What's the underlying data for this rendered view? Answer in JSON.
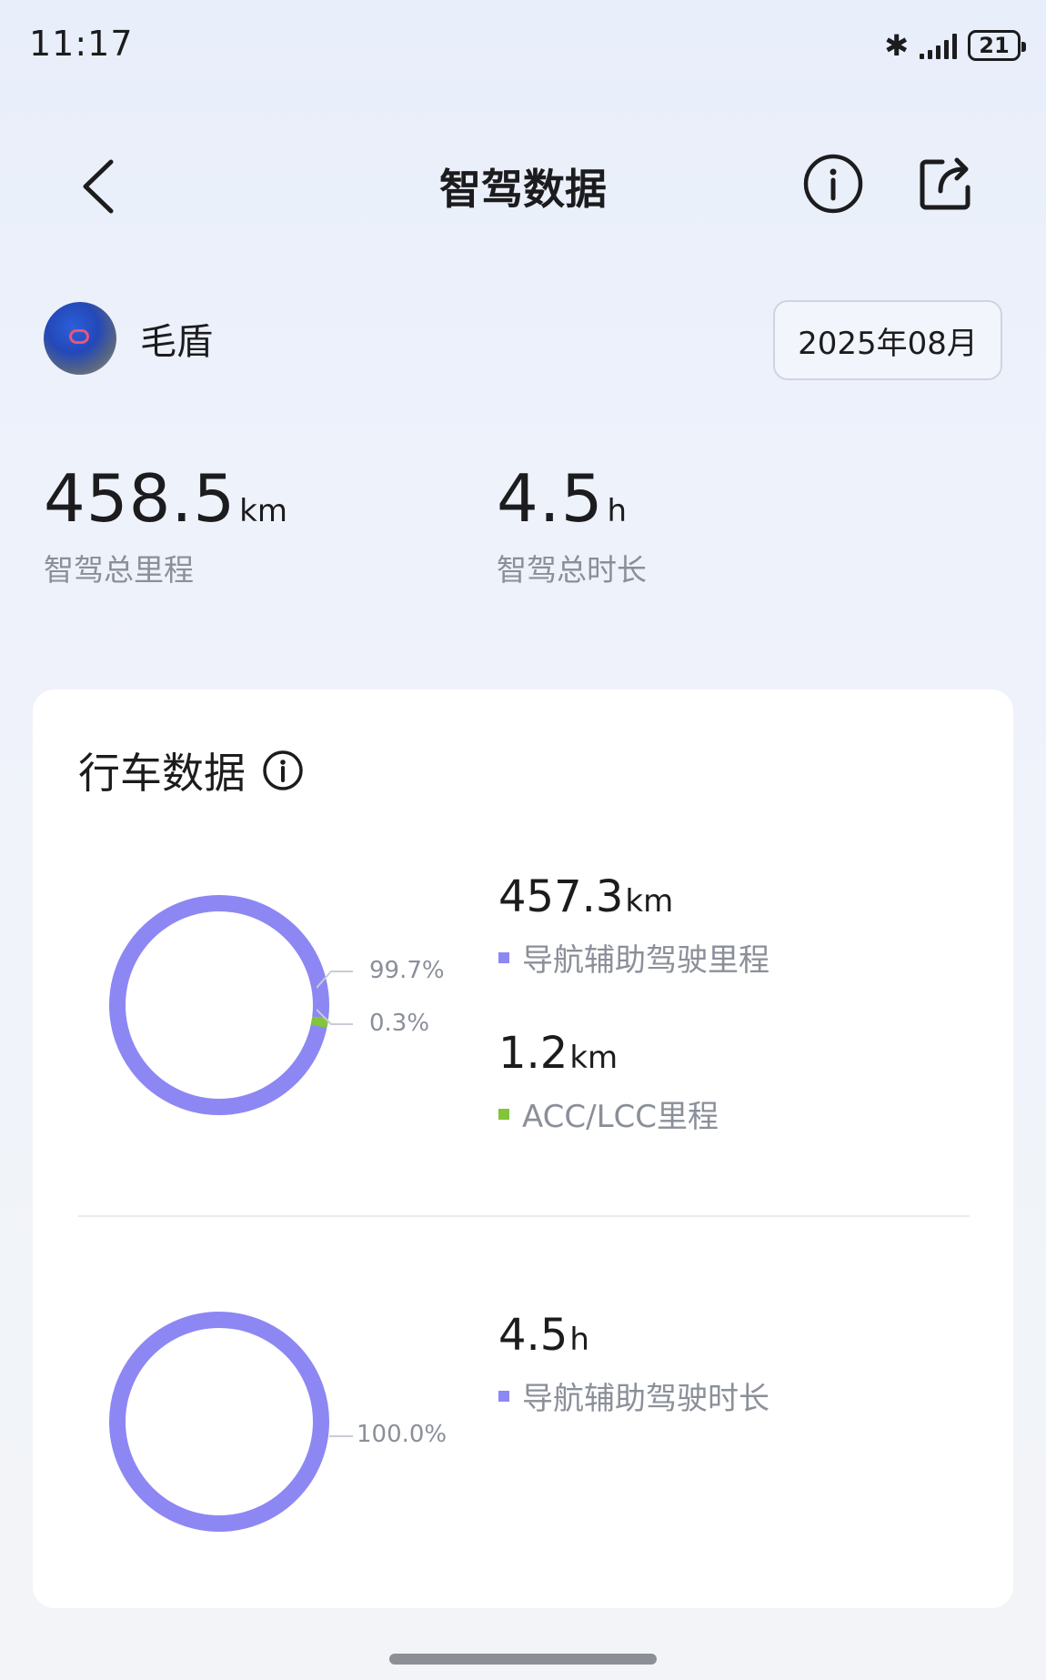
{
  "status_bar": {
    "time": "11:17",
    "battery": "21",
    "icons": [
      "bluetooth-icon",
      "signal-icon",
      "battery-icon"
    ]
  },
  "header": {
    "title": "智驾数据",
    "icons": [
      "back-chevron-icon",
      "info-icon",
      "share-icon"
    ]
  },
  "user": {
    "name": "毛盾"
  },
  "month_selector": {
    "label": "2025年08月"
  },
  "summary": {
    "distance": {
      "value": "458.5",
      "unit": "km",
      "label": "智驾总里程"
    },
    "duration": {
      "value": "4.5",
      "unit": "h",
      "label": "智驾总时长"
    }
  },
  "card": {
    "title": "行车数据",
    "mileage": {
      "segments": [
        {
          "percent_label": "99.7%",
          "fraction": 0.997,
          "color": "#8d87f4"
        },
        {
          "percent_label": "0.3%",
          "fraction": 0.003,
          "color": "#82c43a"
        }
      ],
      "items": [
        {
          "value": "457.3",
          "unit": "km",
          "label": "导航辅助驾驶里程",
          "color": "#8d87f4"
        },
        {
          "value": "1.2",
          "unit": "km",
          "label": "ACC/LCC里程",
          "color": "#82c43a"
        }
      ]
    },
    "duration": {
      "segments": [
        {
          "percent_label": "100.0%",
          "fraction": 1.0,
          "color": "#8d87f4"
        }
      ],
      "items": [
        {
          "value": "4.5",
          "unit": "h",
          "label": "导航辅助驾驶时长",
          "color": "#8d87f4"
        }
      ]
    }
  }
}
